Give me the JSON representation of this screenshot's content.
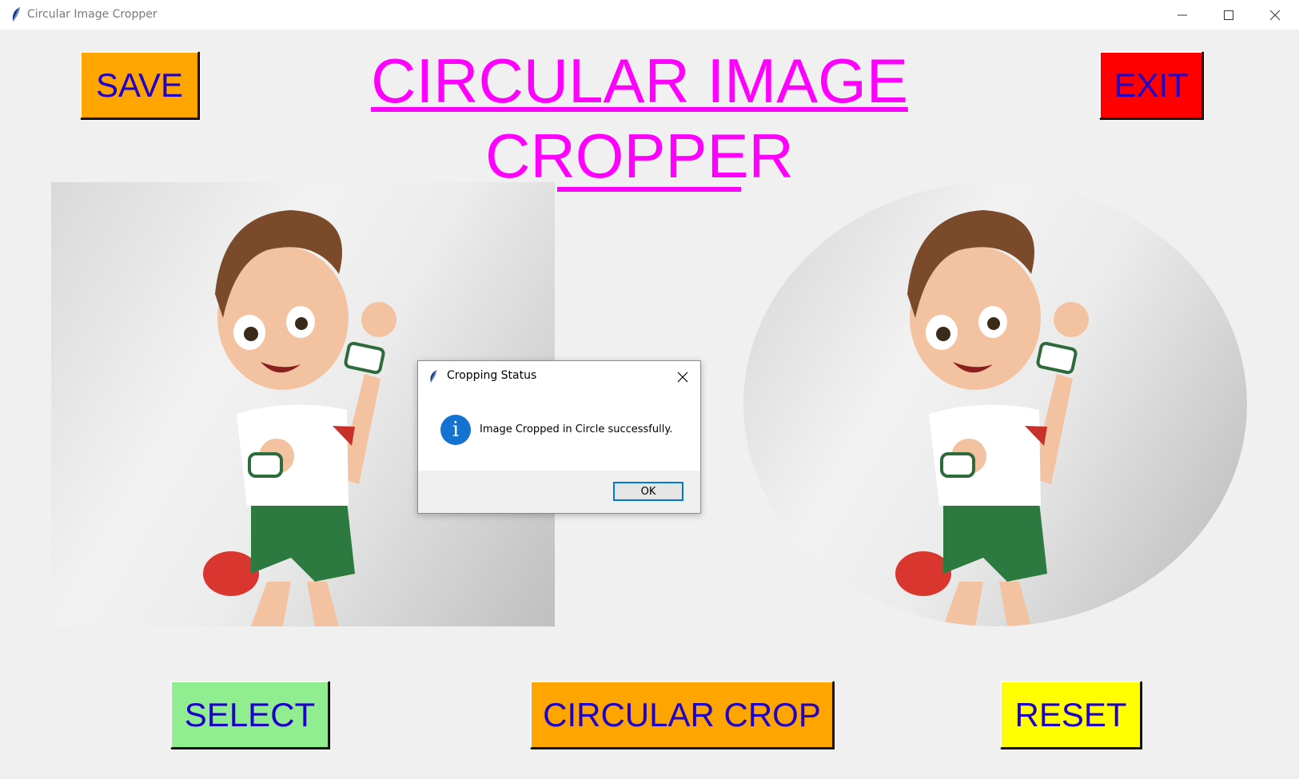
{
  "window": {
    "title": "Circular Image Cropper",
    "controls": [
      "minimize-icon",
      "maximize-icon",
      "close-icon"
    ]
  },
  "header": {
    "title_line1": "CIRCULAR IMAGE",
    "title_line2": "CROPPER",
    "title_color": "#ff00ff"
  },
  "buttons": {
    "save": {
      "label": "SAVE",
      "bg": "#ffa500"
    },
    "exit": {
      "label": "EXIT",
      "bg": "#ff0000"
    },
    "select": {
      "label": "SELECT",
      "bg": "#90ee90"
    },
    "circular_crop": {
      "label": "CIRCULAR CROP",
      "bg": "#ffa500"
    },
    "reset": {
      "label": "RESET",
      "bg": "#ffff00"
    },
    "text_color": "#1f00c9"
  },
  "dialog": {
    "title": "Cropping Status",
    "message": "Image Cropped in Circle successfully.",
    "ok_label": "OK",
    "icon": "info-icon"
  }
}
